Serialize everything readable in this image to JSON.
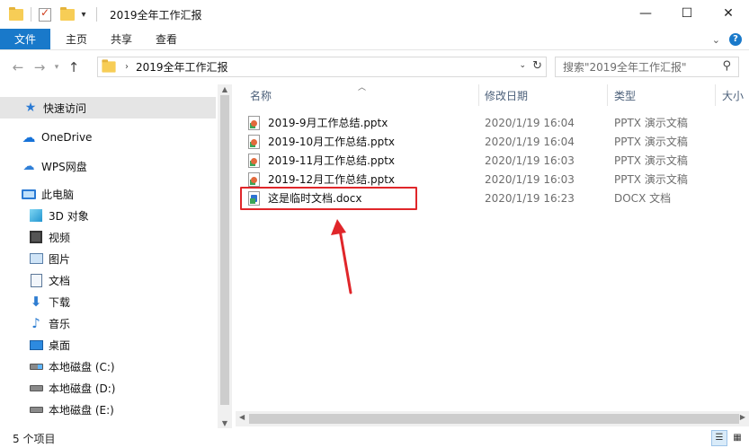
{
  "window": {
    "title": "2019全年工作汇报",
    "controls": [
      "—",
      "☐",
      "✕"
    ]
  },
  "ribbon": {
    "tabs": [
      "文件",
      "主页",
      "共享",
      "查看"
    ]
  },
  "address": {
    "path": "2019全年工作汇报",
    "search_placeholder": "搜索\"2019全年工作汇报\""
  },
  "nav": {
    "items": [
      {
        "label": "快速访问",
        "icon": "star-icon"
      },
      {
        "label": "OneDrive",
        "icon": "cloud-icon"
      },
      {
        "label": "WPS网盘",
        "icon": "wps-cloud-icon"
      },
      {
        "label": "此电脑",
        "icon": "computer-icon"
      },
      {
        "label": "3D 对象",
        "icon": "3d-objects-icon"
      },
      {
        "label": "视频",
        "icon": "video-icon"
      },
      {
        "label": "图片",
        "icon": "pictures-icon"
      },
      {
        "label": "文档",
        "icon": "documents-icon"
      },
      {
        "label": "下载",
        "icon": "download-icon"
      },
      {
        "label": "音乐",
        "icon": "music-icon"
      },
      {
        "label": "桌面",
        "icon": "desktop-icon"
      },
      {
        "label": "本地磁盘 (C:)",
        "icon": "drive-c-icon"
      },
      {
        "label": "本地磁盘 (D:)",
        "icon": "drive-icon"
      },
      {
        "label": "本地磁盘 (E:)",
        "icon": "drive-icon"
      }
    ]
  },
  "columns": {
    "name": "名称",
    "modified": "修改日期",
    "type": "类型",
    "size": "大小"
  },
  "files": [
    {
      "name": "2019-9月工作总结.pptx",
      "modified": "2020/1/19 16:04",
      "type": "PPTX 演示文稿",
      "icon": "pptx-file-icon"
    },
    {
      "name": "2019-10月工作总结.pptx",
      "modified": "2020/1/19 16:04",
      "type": "PPTX 演示文稿",
      "icon": "pptx-file-icon"
    },
    {
      "name": "2019-11月工作总结.pptx",
      "modified": "2020/1/19 16:03",
      "type": "PPTX 演示文稿",
      "icon": "pptx-file-icon"
    },
    {
      "name": "2019-12月工作总结.pptx",
      "modified": "2020/1/19 16:03",
      "type": "PPTX 演示文稿",
      "icon": "pptx-file-icon"
    },
    {
      "name": "这是临时文档.docx",
      "modified": "2020/1/19 16:23",
      "type": "DOCX 文档",
      "icon": "docx-file-icon"
    }
  ],
  "annotation": {
    "highlight_color": "#e0262a",
    "highlighted_file": "这是临时文档.docx"
  },
  "status": {
    "item_count": "5 个项目"
  },
  "colors": {
    "accent": "#1979ca",
    "selection": "#e5e5e5"
  }
}
